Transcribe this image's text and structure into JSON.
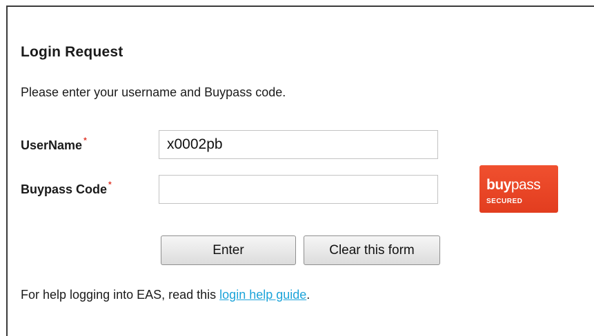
{
  "form": {
    "title": "Login Request",
    "intro": "Please enter your username and Buypass code.",
    "required_marker": "*",
    "username": {
      "label": "UserName",
      "value": "x0002pb"
    },
    "buypass_code": {
      "label": "Buypass Code",
      "value": ""
    },
    "buttons": {
      "enter": "Enter",
      "clear": "Clear this form"
    },
    "help": {
      "prefix": "For help logging into EAS, read this ",
      "link_text": "login help guide",
      "suffix": "."
    }
  },
  "logo": {
    "word_bold": "buy",
    "word_regular": "pass",
    "subtitle": "SECURED",
    "color": "#e8452a"
  },
  "colors": {
    "link": "#1aa3d9",
    "required": "#e0392b"
  }
}
